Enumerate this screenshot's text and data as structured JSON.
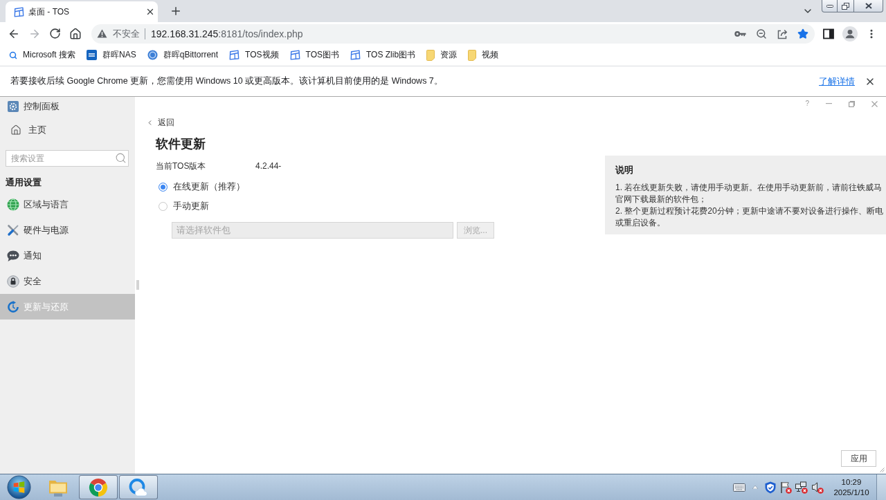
{
  "browser": {
    "tabs": [
      {
        "title": "桌面 - TOS",
        "selected": true
      }
    ],
    "address": {
      "security": "不安全",
      "host": "192.168.31.245",
      "path": ":8181/tos/index.php",
      "bookmarked": true
    },
    "bookmarks": [
      {
        "kind": "search",
        "label": "Microsoft 搜索"
      },
      {
        "kind": "dsm",
        "label": "群晖NAS"
      },
      {
        "kind": "qbittorrent",
        "label": "群晖qBittorrent"
      },
      {
        "kind": "tos",
        "label": "TOS视频"
      },
      {
        "kind": "tos",
        "label": "TOS图书"
      },
      {
        "kind": "tos",
        "label": "TOS Zlib图书"
      },
      {
        "kind": "folder",
        "label": "资源"
      },
      {
        "kind": "folder",
        "label": "视频"
      }
    ],
    "infobar": {
      "message": "若要接收后续 Google Chrome 更新，您需使用 Windows 10 或更高版本。该计算机目前使用的是 Windows 7。",
      "link": "了解详情"
    }
  },
  "sidebar": {
    "title": "控制面板",
    "home": "主页",
    "search": {
      "placeholder": "搜索设置"
    },
    "section": "通用设置",
    "items": [
      {
        "kind": "region",
        "label": "区域与语言",
        "selected": false
      },
      {
        "kind": "hardware",
        "label": "硬件与电源",
        "selected": false
      },
      {
        "kind": "notification",
        "label": "通知",
        "selected": false
      },
      {
        "kind": "security",
        "label": "安全",
        "selected": false
      },
      {
        "kind": "update",
        "label": "更新与还原",
        "selected": true
      }
    ]
  },
  "dialog": {
    "help": "?"
  },
  "update": {
    "back": "返回",
    "title": "软件更新",
    "version": {
      "label": "当前TOS版本",
      "value": "4.2.44-"
    },
    "options": [
      {
        "label": "在线更新（推荐）",
        "selected": true
      },
      {
        "label": "手动更新",
        "selected": false
      }
    ],
    "file": {
      "placeholder": "请选择软件包",
      "disabled": true
    },
    "browse": {
      "label": "浏览...",
      "disabled": true
    },
    "apply": "应用"
  },
  "notes": {
    "title": "说明",
    "lines": [
      "1. 若在线更新失败，请使用手动更新。在使用手动更新前，请前往铁威马官网下载最新的软件包；",
      "2. 整个更新过程预计花费20分钟；更新中途请不要对设备进行操作、断电或重启设备。"
    ]
  },
  "taskbar": {
    "apps": [
      {
        "kind": "explorer",
        "running": false
      },
      {
        "kind": "browser",
        "running": true
      },
      {
        "kind": "cloud",
        "running": true
      }
    ],
    "tray": [
      {
        "kind": "keyboard",
        "alert": false
      },
      {
        "kind": "expand",
        "alert": false
      },
      {
        "kind": "shield",
        "alert": false
      },
      {
        "kind": "flag",
        "alert": true
      },
      {
        "kind": "network",
        "alert": true
      },
      {
        "kind": "volume",
        "alert": true
      }
    ],
    "time": "10:29",
    "date": "2025/1/10"
  }
}
